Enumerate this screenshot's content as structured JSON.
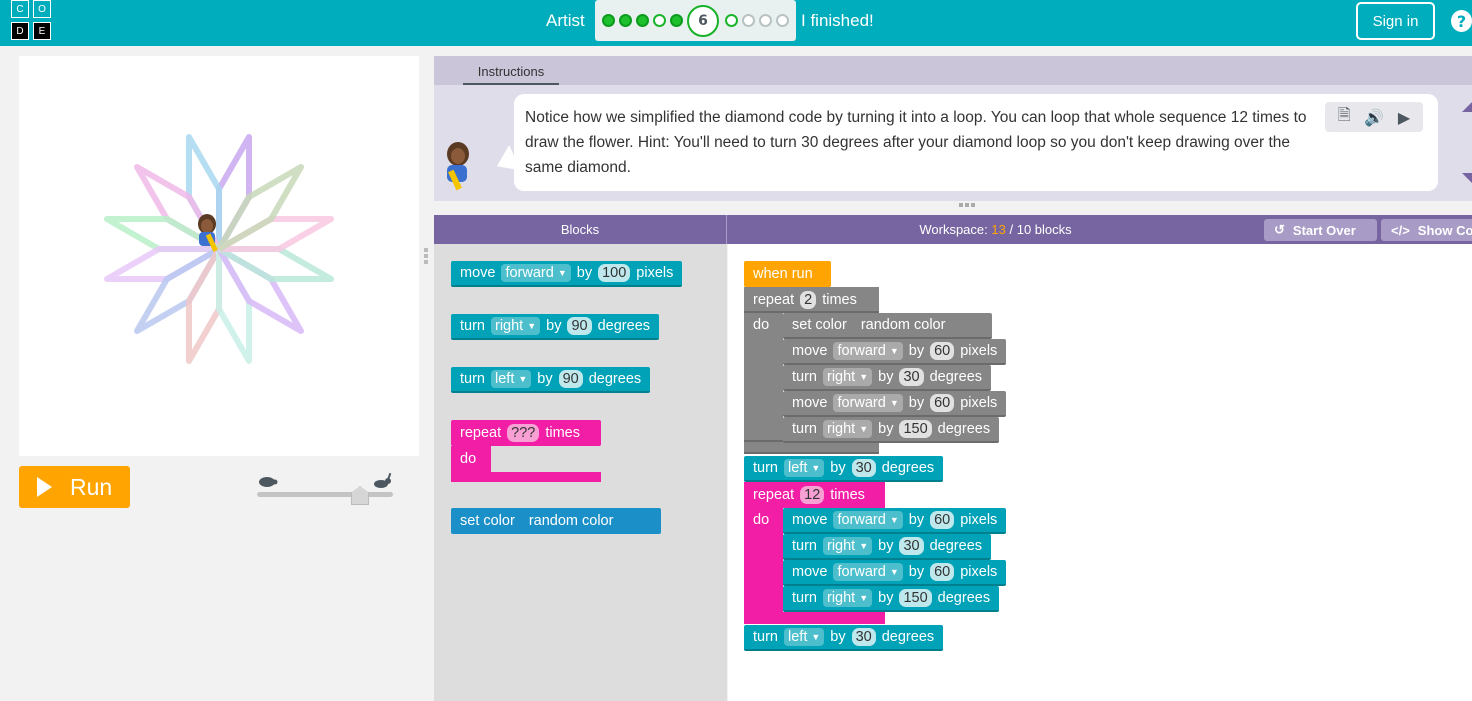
{
  "header": {
    "logo_letters": [
      "C",
      "O",
      "D",
      "E"
    ],
    "level_name": "Artist",
    "current_level": "6",
    "finished_text": "I finished!",
    "sign_in": "Sign in",
    "help": "?",
    "progress": {
      "completed_before": 5,
      "current": 6,
      "remaining_after": 4
    },
    "brand_color": "#00adbc"
  },
  "stage": {
    "run_label": "Run",
    "speed_level": 0.74
  },
  "instructions": {
    "tab_label": "Instructions",
    "text": "Notice how we simplified the diamond code by turning it into a loop. You can loop that whole sequence 12 times to draw the flower. Hint: You'll need to turn 30 degrees after your diamond loop so you don't keep drawing over the same diamond."
  },
  "toolbox": {
    "title": "Blocks",
    "blocks": [
      {
        "words": [
          "move",
          "forward",
          "by",
          "100",
          "pixels"
        ]
      },
      {
        "words": [
          "turn",
          "right",
          "by",
          "90",
          "degrees"
        ]
      },
      {
        "words": [
          "turn",
          "left",
          "by",
          "90",
          "degrees"
        ]
      },
      {
        "words": [
          "repeat",
          "???",
          "times",
          "do"
        ]
      },
      {
        "words": [
          "set color",
          "random color"
        ]
      }
    ]
  },
  "workspace": {
    "label": "Workspace:",
    "count": "13",
    "limit": "/ 10 blocks",
    "start_over": "Start Over",
    "show_code": "Show Code",
    "program": {
      "when_run": "when run",
      "repeat1": {
        "kw": "repeat",
        "n": "2",
        "times": "times",
        "do": "do"
      },
      "set_color": {
        "kw": "set color",
        "value": "random color"
      },
      "move1": {
        "kw": "move",
        "dir": "forward",
        "by": "by",
        "n": "60",
        "unit": "pixels"
      },
      "turn1": {
        "kw": "turn",
        "dir": "right",
        "by": "by",
        "n": "30",
        "unit": "degrees"
      },
      "move2": {
        "kw": "move",
        "dir": "forward",
        "by": "by",
        "n": "60",
        "unit": "pixels"
      },
      "turn2": {
        "kw": "turn",
        "dir": "right",
        "by": "by",
        "n": "150",
        "unit": "degrees"
      },
      "turn_left1": {
        "kw": "turn",
        "dir": "left",
        "by": "by",
        "n": "30",
        "unit": "degrees"
      },
      "repeat2": {
        "kw": "repeat",
        "n": "12",
        "times": "times",
        "do": "do"
      },
      "move3": {
        "kw": "move",
        "dir": "forward",
        "by": "by",
        "n": "60",
        "unit": "pixels"
      },
      "turn3": {
        "kw": "turn",
        "dir": "right",
        "by": "by",
        "n": "30",
        "unit": "degrees"
      },
      "move4": {
        "kw": "move",
        "dir": "forward",
        "by": "by",
        "n": "60",
        "unit": "pixels"
      },
      "turn4": {
        "kw": "turn",
        "dir": "right",
        "by": "by",
        "n": "150",
        "unit": "degrees"
      },
      "turn_left2": {
        "kw": "turn",
        "dir": "left",
        "by": "by",
        "n": "30",
        "unit": "degrees"
      }
    }
  },
  "colors": {
    "block_teal": "#00a2b7",
    "block_pink": "#f21ea5",
    "block_gray": "#868686",
    "block_orange": "#ffa400",
    "block_blue": "#1a8fc8",
    "purple_header": "#7665a0"
  }
}
